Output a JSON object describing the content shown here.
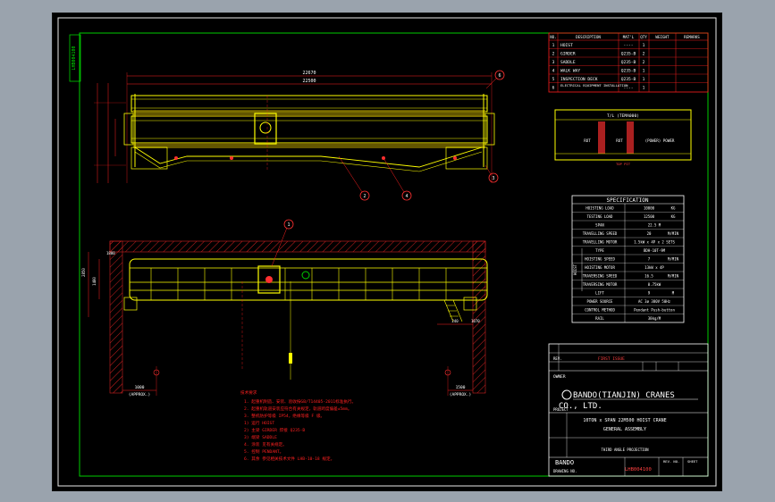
{
  "drawing_number_side": "LHB004100",
  "elevation": {
    "dim_overall": "22670",
    "dim_span": "22500",
    "balloons": [
      "6",
      "2",
      "4",
      "3",
      "1"
    ]
  },
  "bom": {
    "headers": [
      "NO.",
      "DESCRIPTION",
      "MAT'L",
      "QTY",
      "WEIGHT",
      "REMARKS"
    ],
    "rows": [
      {
        "no": "1",
        "desc": "HOIST",
        "mat": "----",
        "qty": "1"
      },
      {
        "no": "2",
        "desc": "GIRDER",
        "mat": "Q235-B",
        "qty": "2"
      },
      {
        "no": "3",
        "desc": "SADDLE",
        "mat": "Q235-B",
        "qty": "2"
      },
      {
        "no": "4",
        "desc": "WALK WAY",
        "mat": "Q235-B",
        "qty": "1"
      },
      {
        "no": "5",
        "desc": "INSPECTION DECK",
        "mat": "Q235-B",
        "qty": "1"
      },
      {
        "no": "6",
        "desc": "ELECTRICAL EQUIPMENT INSTALLATION",
        "mat": "----",
        "qty": "1"
      }
    ]
  },
  "section": {
    "title": "T/L (TEMA000)",
    "label_left": "ROT",
    "label_mid": "ROT",
    "label_right": "(POWER) POWER",
    "bottom": "TOP PIT"
  },
  "spec": {
    "title": "SPECIFICATION",
    "rows": [
      {
        "k": "HOISTING LOAD",
        "v": "10000",
        "u": "KG"
      },
      {
        "k": "TESTING LOAD",
        "v": "12500",
        "u": "KG"
      },
      {
        "k": "SPAN",
        "v": "22.5 M",
        "u": ""
      },
      {
        "k": "TRAVELLING SPEED",
        "v": "20",
        "u": "M/MIN"
      },
      {
        "k": "TRAVELLING MOTOR",
        "v": "1.5kW x 4P x 2 SETS",
        "u": ""
      },
      {
        "k": "TYPE",
        "v": "BDH-10T-9M",
        "u": ""
      },
      {
        "k": "HOISTING SPEED",
        "v": "7",
        "u": "M/MIN"
      },
      {
        "k": "HOISTING MOTOR",
        "v": "13kW x 4P",
        "u": ""
      },
      {
        "k": "TRAVERSING SPEED",
        "v": "16.5",
        "u": "M/MIN"
      },
      {
        "k": "TRAVERSING MOTOR",
        "v": "0.75kW",
        "u": ""
      },
      {
        "k": "LIFT",
        "v": "9",
        "u": "M"
      },
      {
        "k": "POWER SOURCE",
        "v": "AC 3ø 380V 50Hz",
        "u": ""
      },
      {
        "k": "CONTROL METHOD",
        "v": "Pendant Push-button",
        "u": ""
      },
      {
        "k": "RAIL",
        "v": "38kg/M",
        "u": ""
      }
    ],
    "hoist_label": "HOIST"
  },
  "end_view": {
    "dim_left": "1000",
    "dim_right": "1500",
    "approx_left": "(APPROX.)",
    "approx_right": "(APPROX.)",
    "dim_a": "2850",
    "dim_b": "1480",
    "dim_c": "1800",
    "dim_d": "240",
    "dim_e": "1070"
  },
  "notes": {
    "title": "技术要求",
    "lines": [
      "1. 起重机制造、安装、验收按GB/T14405-2011标准执行。",
      "2. 起重机轨道安装应符合有关规定，轨道跨度偏差±5mm。",
      "3. 整机防护等级 IP54，绝缘等级 F 级。",
      "  1) 运行 HOIST",
      "  2) 主梁 GIRDER 焊接 Q235-B",
      "  3) 端梁 SADDLE",
      "4. 涂装 见有关规定。",
      "5. 控制 PENDANT。",
      "6. 其余 参见相关技术文件 LHB-10-18 规定。"
    ]
  },
  "title_block": {
    "rev_label": "REV.",
    "first_issue": "FIRST ISSUE",
    "owner": "OWNER",
    "company_1": "BANDO(TIANJIN) CRANES",
    "company_2": "CO., LTD.",
    "project": "PROJECT",
    "title_1": "10TON x SPAN 22M500 HOIST CRANE",
    "title_2": "GENERAL ASSEMBLY",
    "third_angle": "THIRD ANGLE PROJECTION",
    "brand": "BANDO",
    "drawing_no_label": "DRAWING NO.",
    "drawing_no": "LHB004100",
    "rev_no_label": "REV. NO.",
    "sheet_label": "SHEET"
  },
  "colors": {
    "background": "#000000",
    "frame": "#ffffff",
    "border": "#00cc00",
    "table_line": "#ff2020",
    "text": "#ffffff",
    "crane": "#ffff00",
    "hatch": "#cc2020",
    "dimension": "#ff2020",
    "balloon": "#ff3030"
  }
}
